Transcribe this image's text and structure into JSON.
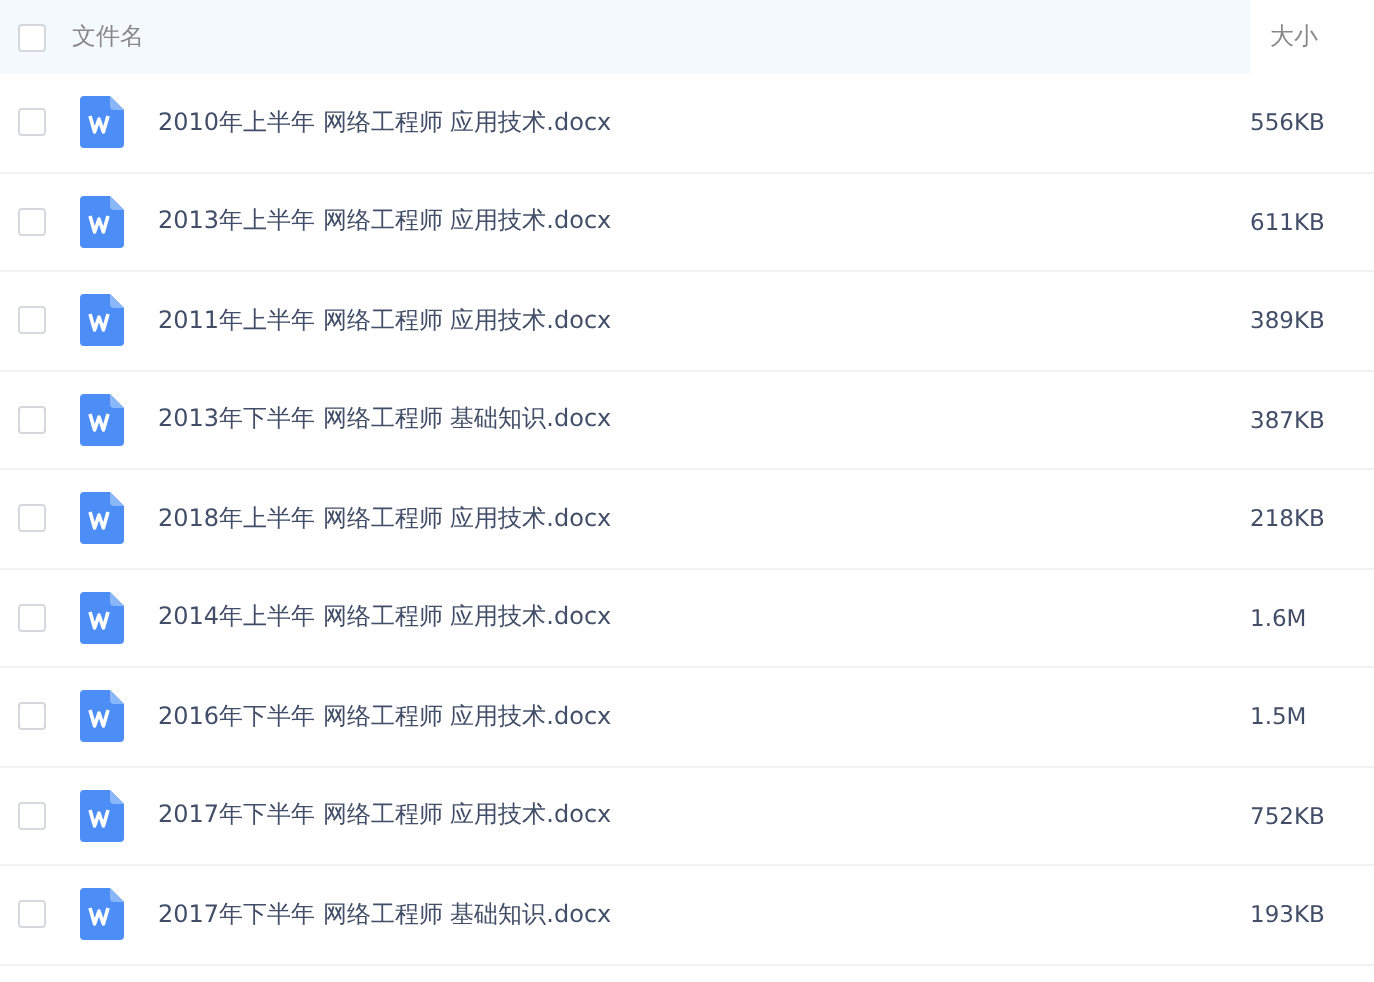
{
  "header": {
    "checked": false,
    "name_label": "文件名",
    "size_label": "大小"
  },
  "files": [
    {
      "name": "2010年上半年 网络工程师 应用技术.docx",
      "size": "556KB",
      "checked": false
    },
    {
      "name": "2013年上半年 网络工程师 应用技术.docx",
      "size": "611KB",
      "checked": false
    },
    {
      "name": "2011年上半年 网络工程师 应用技术.docx",
      "size": "389KB",
      "checked": false
    },
    {
      "name": "2013年下半年 网络工程师 基础知识.docx",
      "size": "387KB",
      "checked": false
    },
    {
      "name": "2018年上半年 网络工程师 应用技术.docx",
      "size": "218KB",
      "checked": false
    },
    {
      "name": "2014年上半年 网络工程师 应用技术.docx",
      "size": "1.6M",
      "checked": false
    },
    {
      "name": "2016年下半年 网络工程师 应用技术.docx",
      "size": "1.5M",
      "checked": false
    },
    {
      "name": "2017年下半年 网络工程师 应用技术.docx",
      "size": "752KB",
      "checked": false
    },
    {
      "name": "2017年下半年 网络工程师 基础知识.docx",
      "size": "193KB",
      "checked": false
    }
  ]
}
